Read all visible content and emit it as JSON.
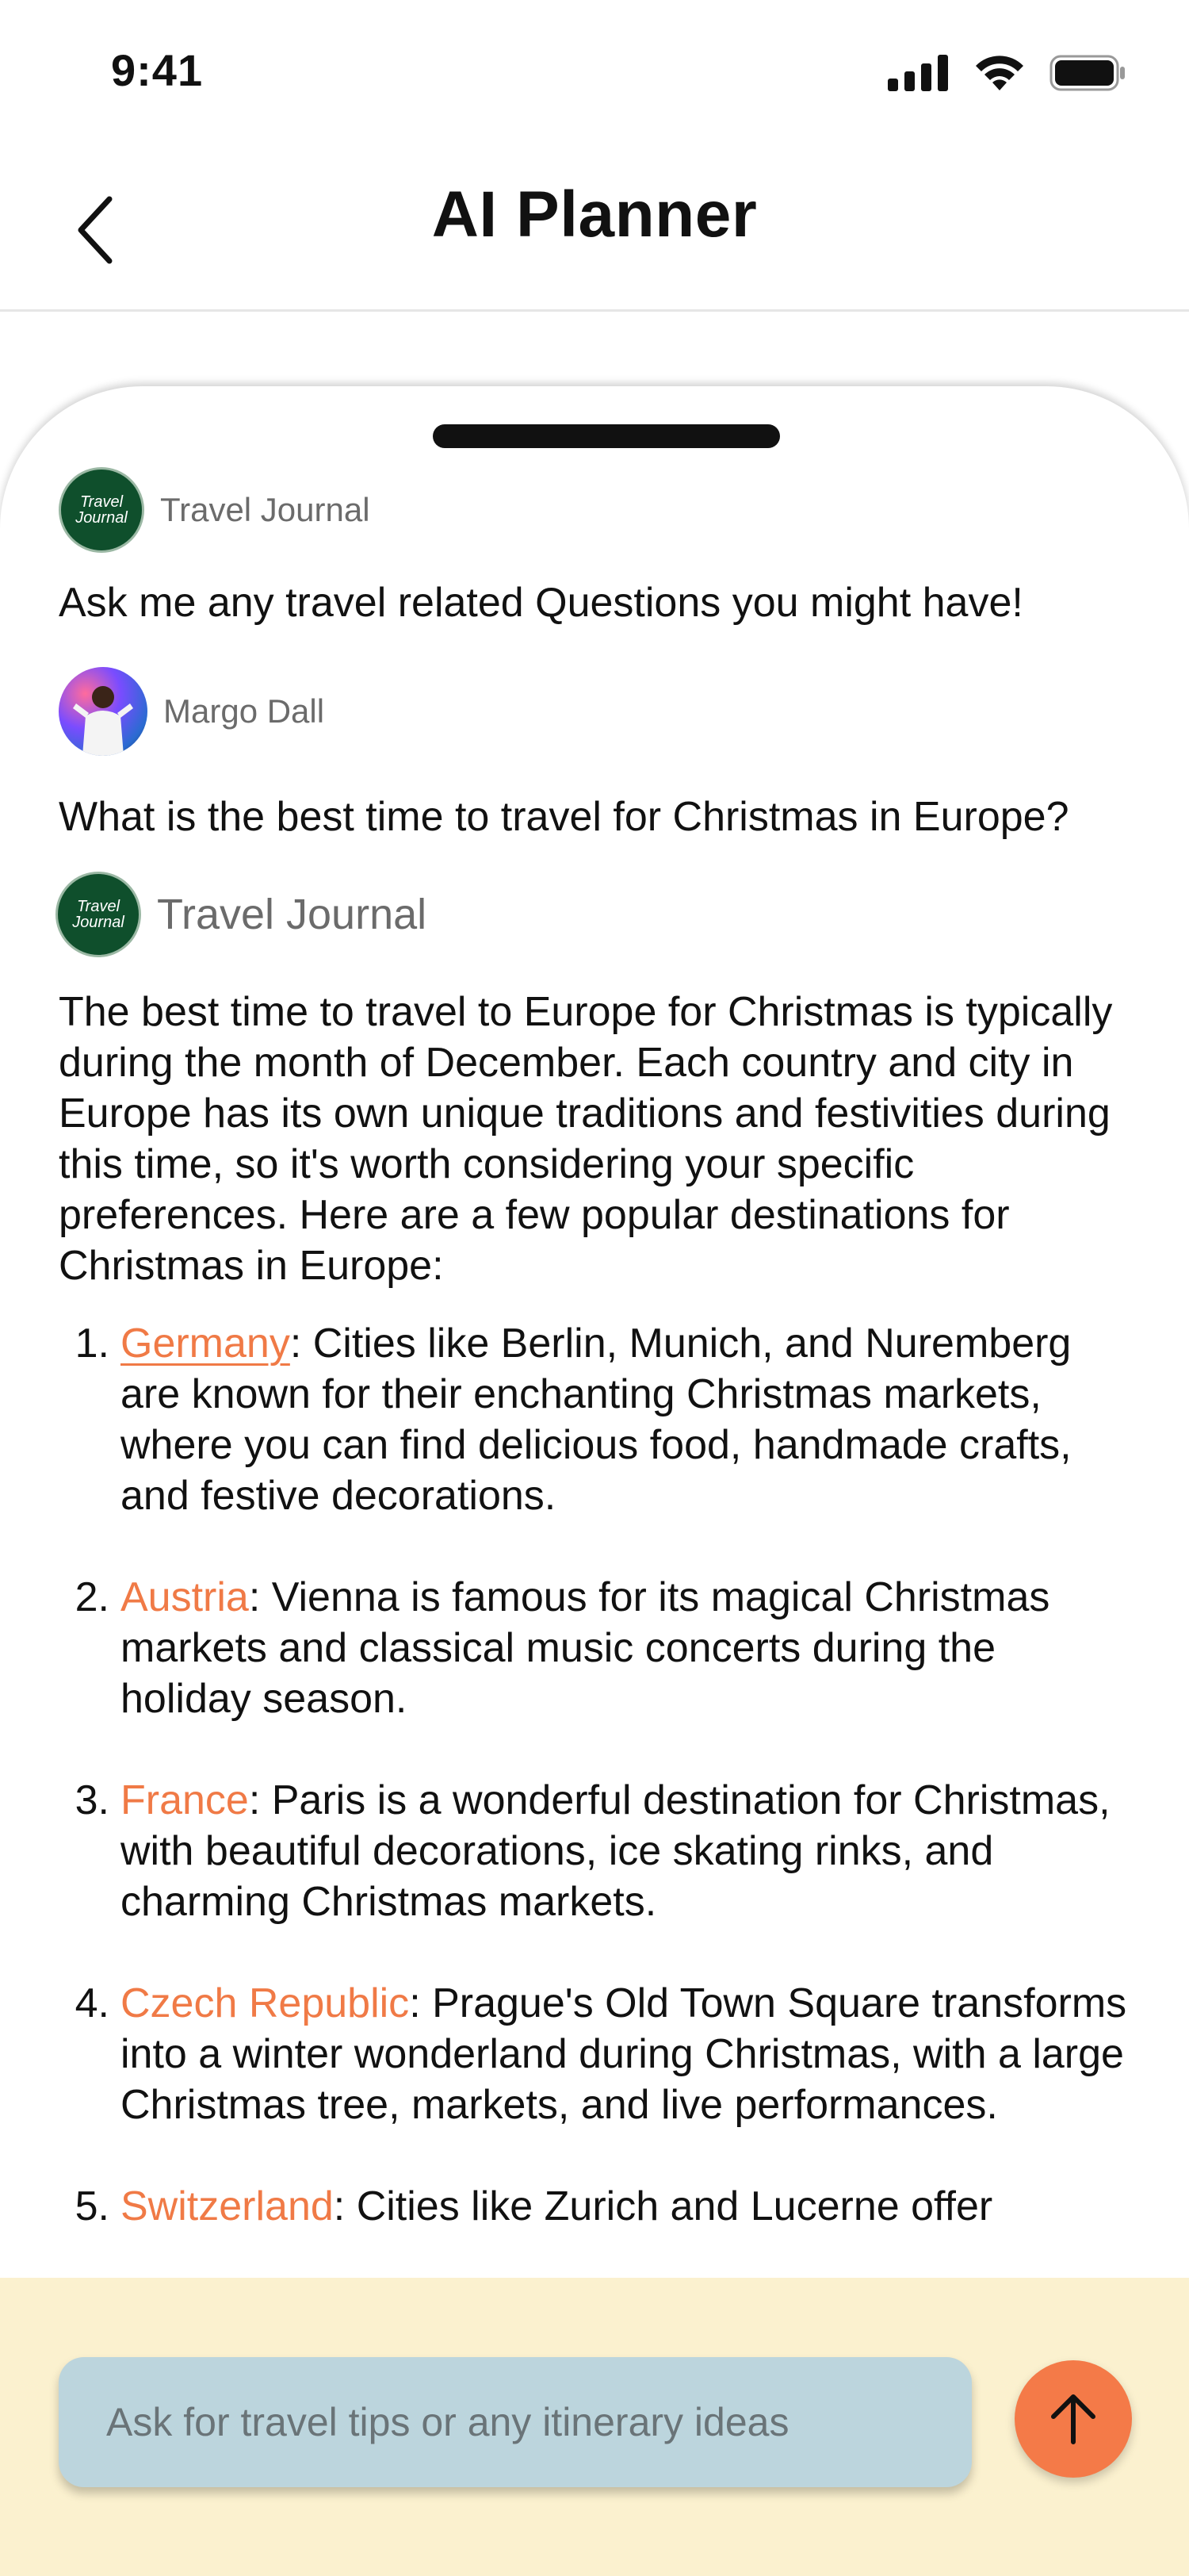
{
  "status_bar": {
    "time": "9:41"
  },
  "header": {
    "title": "AI Planner"
  },
  "chat": {
    "messages": [
      {
        "sender": "Travel Journal",
        "text": "Ask me any travel related Questions you might have!"
      },
      {
        "sender": "Margo Dall",
        "text": "What is the best time to travel for Christmas in Europe?"
      },
      {
        "sender": "Travel Journal",
        "text": "The best time to travel to Europe for Christmas is typically during the month of December. Each country and city in Europe has its own unique traditions and festivities during this time, so it's worth considering your specific preferences. Here are a few popular destinations for Christmas in Europe:"
      }
    ],
    "avatar_logo_text": [
      "Travel",
      "Journal"
    ],
    "answer_items": [
      {
        "number": "1.",
        "place": "Germany",
        "text": ": Cities like Berlin, Munich, and Nuremberg are known for their enchanting Christmas markets, where you can find delicious food, handmade crafts, and festive decorations."
      },
      {
        "number": "2.",
        "place": "Austria",
        "text": ": Vienna is famous for its magical Christmas markets and classical music concerts during the holiday season."
      },
      {
        "number": "3.",
        "place": "France",
        "text": ": Paris is a wonderful destination for Christmas, with beautiful decorations, ice skating rinks, and charming Christmas markets."
      },
      {
        "number": "4.",
        "place": "Czech Republic",
        "text": ": Prague's Old Town Square transforms into a winter wonderland during Christmas, with a large Christmas tree, markets, and live performances."
      },
      {
        "number": "5.",
        "place": "Switzerland",
        "text": ": Cities like Zurich and Lucerne offer"
      }
    ]
  },
  "composer": {
    "placeholder": "Ask for travel tips or any itinerary ideas"
  },
  "colors": {
    "accent": "#f47a48",
    "link": "#f07a46",
    "composer_bg": "#fbf1cf",
    "input_bg": "#bcd5dd",
    "logo_green": "#0f4f2c"
  },
  "icons": {
    "back": "chevron-left-icon",
    "send": "arrow-up-icon",
    "signal": "cellular-signal-icon",
    "wifi": "wifi-icon",
    "battery": "battery-icon"
  }
}
